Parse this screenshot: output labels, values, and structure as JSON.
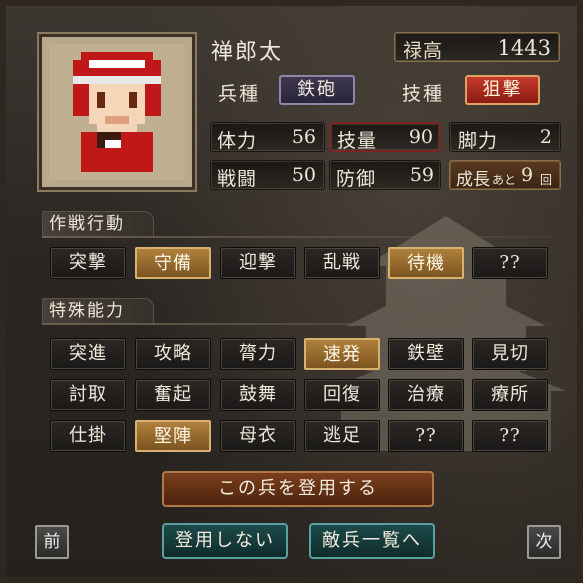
{
  "unit": {
    "name": "禅郎太",
    "stipend_label": "禄高",
    "stipend_value": "1443",
    "troop_type_label": "兵種",
    "troop_type_value": "鉄砲",
    "skill_type_label": "技種",
    "skill_type_value": "狙撃"
  },
  "stats": [
    {
      "label": "体力",
      "value": "56"
    },
    {
      "label": "技量",
      "value": "90"
    },
    {
      "label": "脚力",
      "value": "2"
    },
    {
      "label": "戦闘",
      "value": "50"
    },
    {
      "label": "防御",
      "value": "59"
    }
  ],
  "growth": {
    "label": "成長",
    "remaining_prefix": "あと",
    "count": "9",
    "suffix": "回"
  },
  "tactics": {
    "title": "作戦行動",
    "buttons": [
      "突撃",
      "守備",
      "迎撃",
      "乱戦",
      "待機",
      "??"
    ],
    "selected": [
      "守備",
      "待機"
    ]
  },
  "abilities": {
    "title": "特殊能力",
    "rows": [
      [
        "突進",
        "攻略",
        "膂力",
        "速発",
        "鉄壁",
        "見切"
      ],
      [
        "討取",
        "奮起",
        "鼓舞",
        "回復",
        "治療",
        "療所"
      ],
      [
        "仕掛",
        "堅陣",
        "母衣",
        "逃足",
        "??",
        "??"
      ]
    ],
    "selected": [
      "速発",
      "堅陣"
    ]
  },
  "actions": {
    "recruit": "この兵を登用する",
    "decline": "登用しない",
    "enemy_list": "敵兵一覧へ",
    "prev": "前",
    "next": "次"
  },
  "colors": {
    "selected": "#b0813c",
    "troop_type": "#3d3850",
    "skill_type": "#c63a2a",
    "recruit": "#7a3e1c",
    "secondary": "#1d4a4a"
  }
}
